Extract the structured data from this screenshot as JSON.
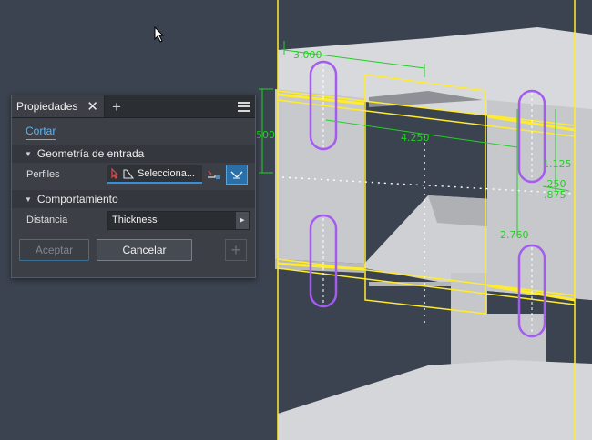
{
  "panel": {
    "tab_title": "Propiedades",
    "close_glyph": "✕",
    "add_tab_glyph": "+",
    "subtab_label": "Cortar",
    "section_input": "Geometría de entrada",
    "profiles_label": "Perfiles",
    "profiles_value": "Selecciona...",
    "section_behavior": "Comportamiento",
    "distance_label": "Distancia",
    "distance_value": "Thickness",
    "accept_label": "Aceptar",
    "cancel_label": "Cancelar",
    "plus_glyph": "+"
  },
  "model": {
    "dimensions": [
      "3.000",
      "500",
      "4.250",
      "1.125",
      ".250",
      ".875",
      "2.760"
    ]
  },
  "colors": {
    "background": "#3b4350",
    "sketch_yellow": "#ffec2b",
    "dimension_green": "#21d021",
    "slot_purple": "#a45bf0",
    "accent_blue": "#3b8fd6"
  }
}
